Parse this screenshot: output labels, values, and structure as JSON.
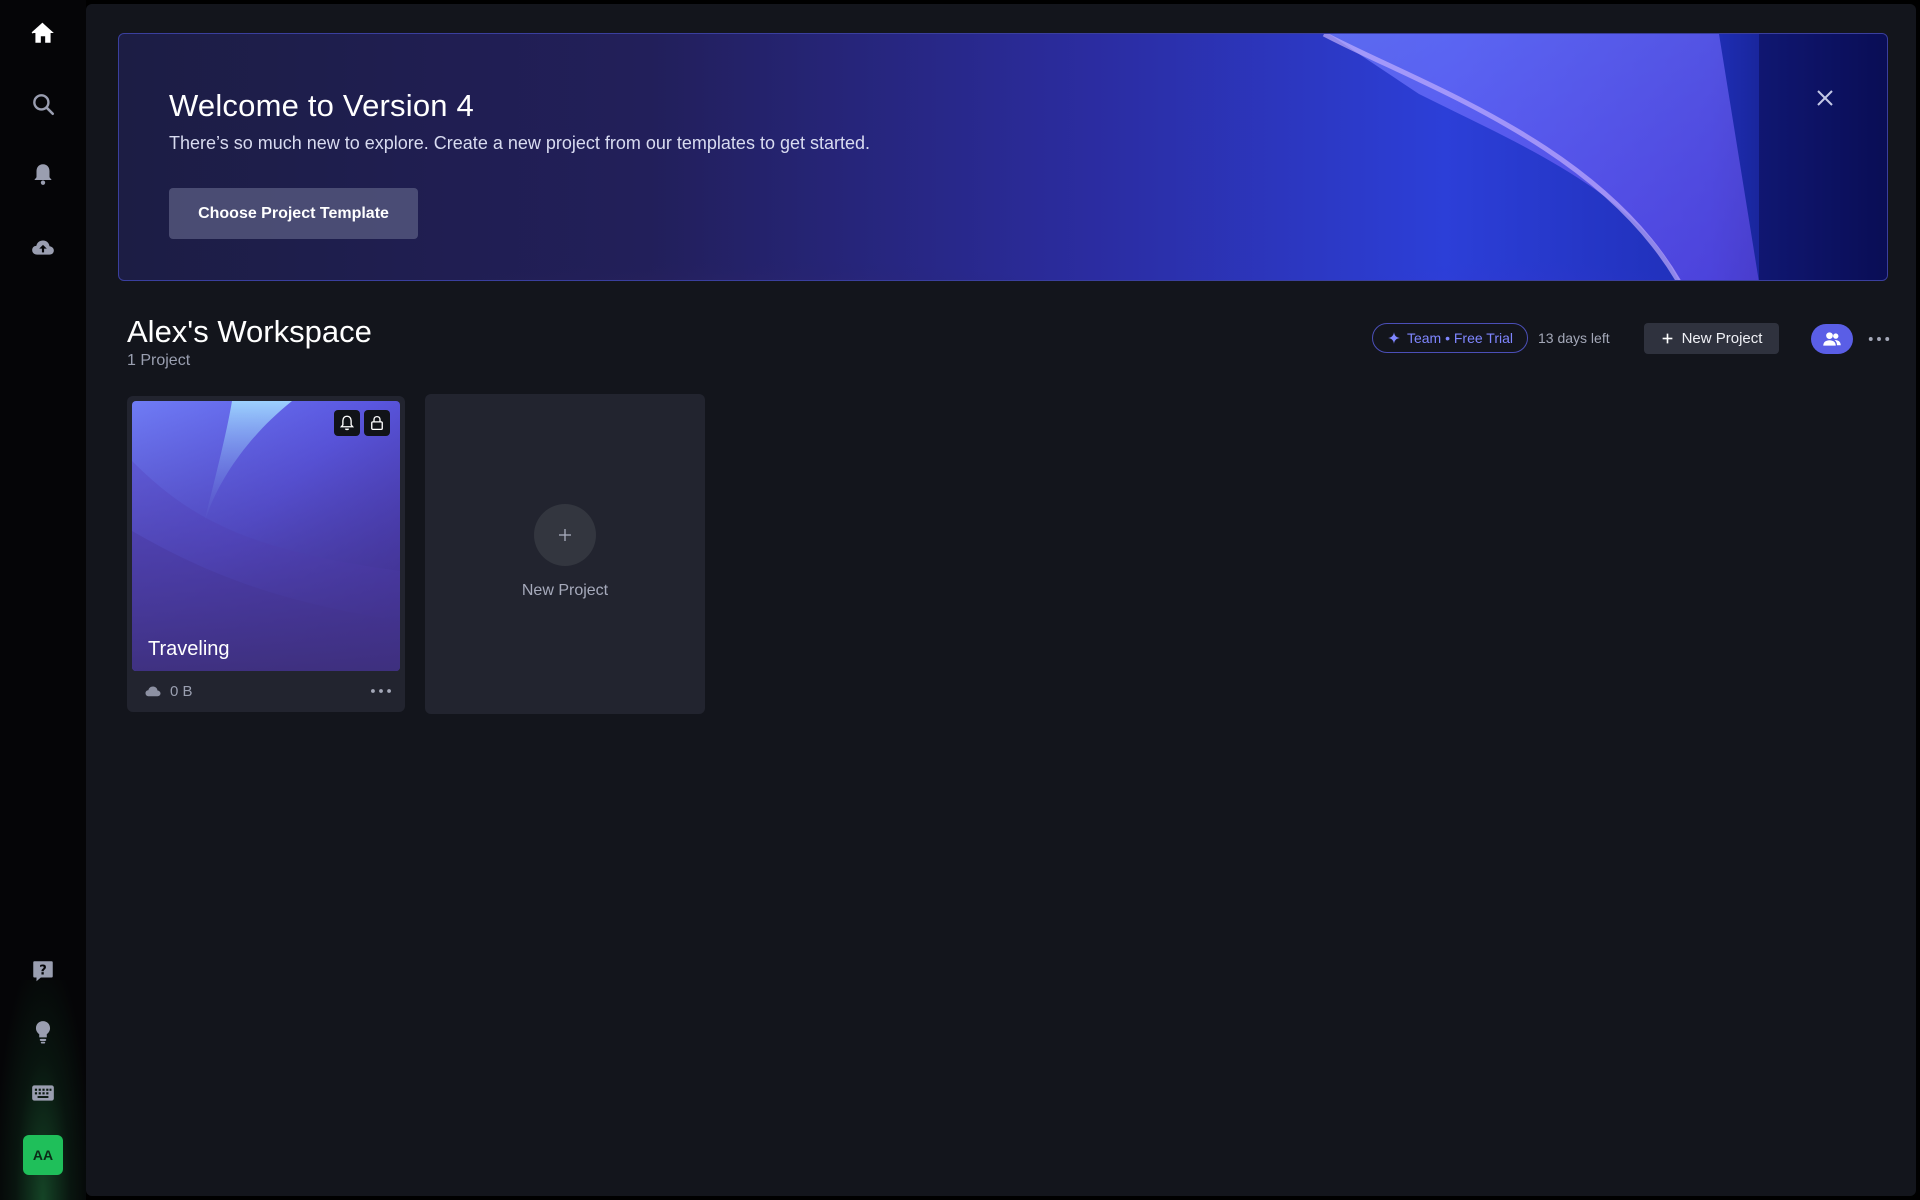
{
  "sidebar": {
    "top_items": [
      {
        "icon": "home-icon",
        "label": "Home"
      },
      {
        "icon": "search-icon",
        "label": "Search"
      },
      {
        "icon": "bell-icon",
        "label": "Notifications"
      },
      {
        "icon": "cloud-upload-icon",
        "label": "Upload"
      }
    ],
    "bottom_items": [
      {
        "icon": "help-icon",
        "label": "Help"
      },
      {
        "icon": "lightbulb-icon",
        "label": "Ideas"
      },
      {
        "icon": "keyboard-icon",
        "label": "Keyboard shortcuts"
      }
    ],
    "avatar_initials": "AA",
    "avatar_color": "#1fbf5a"
  },
  "banner": {
    "title": "Welcome to Version 4",
    "subtitle": "There’s so much new to explore. Create a new project from our templates to get started.",
    "button_label": "Choose Project Template",
    "close_icon": "close-icon"
  },
  "workspace": {
    "title": "Alex's Workspace",
    "project_count": "1 Project",
    "plan_badge": "Team • Free Trial",
    "days_left": "13 days left",
    "new_project_label": "New Project",
    "accent_color": "#5a5ee6"
  },
  "projects": [
    {
      "name": "Traveling",
      "size": "0 B",
      "icons": [
        "bell-icon",
        "lock-icon"
      ]
    }
  ],
  "new_project_card": {
    "label": "New Project"
  }
}
